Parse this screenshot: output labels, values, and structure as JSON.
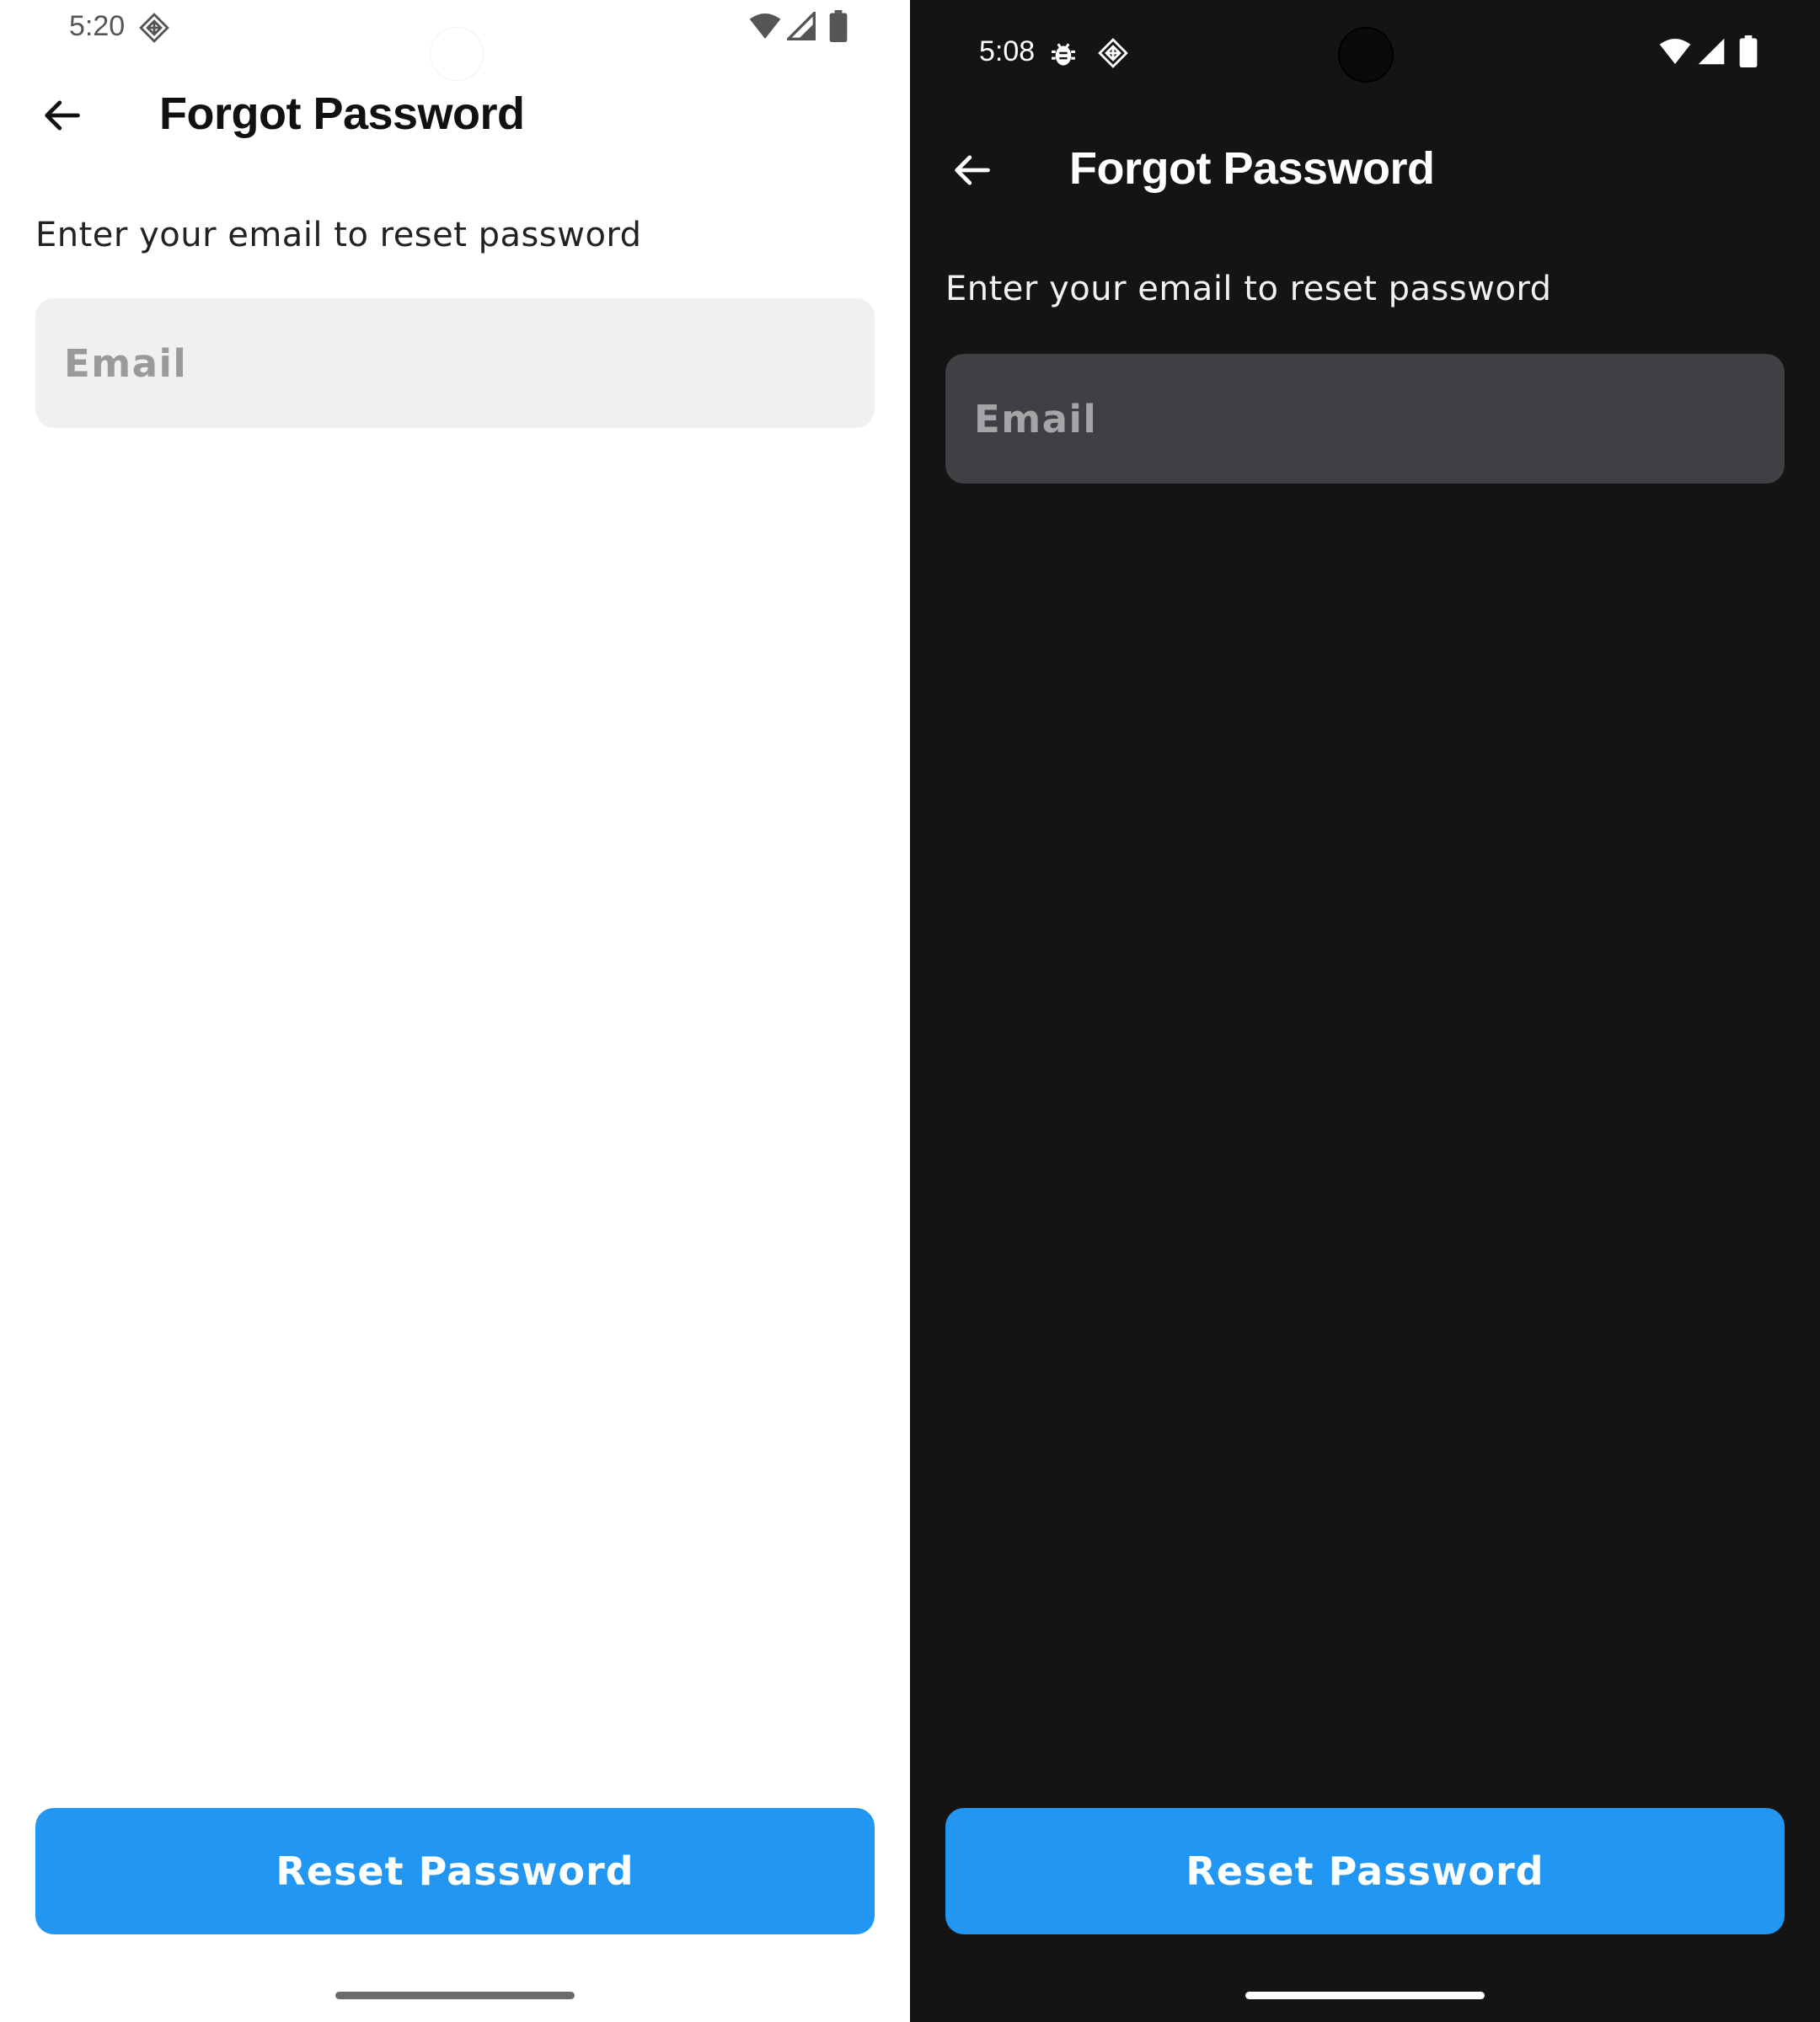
{
  "screens": {
    "light": {
      "status_bar": {
        "time": "5:20",
        "icons": [
          "app-notification-icon",
          "wifi-icon",
          "cellular-signal-icon",
          "battery-icon"
        ]
      },
      "title": "Forgot Password",
      "subtitle": "Enter your email to reset password",
      "email_placeholder": "Email",
      "reset_button_label": "Reset Password"
    },
    "dark": {
      "status_bar": {
        "time": "5:08",
        "icons": [
          "debug-bug-icon",
          "app-notification-icon",
          "wifi-icon",
          "cellular-signal-icon",
          "battery-icon"
        ]
      },
      "title": "Forgot Password",
      "subtitle": "Enter your email to reset password",
      "email_placeholder": "Email",
      "reset_button_label": "Reset Password"
    }
  },
  "colors": {
    "accent": "#2196f3",
    "light_background": "#ffffff",
    "light_input_background": "#f0f0f0",
    "dark_background": "#141414",
    "dark_input_background": "#3f4043"
  }
}
